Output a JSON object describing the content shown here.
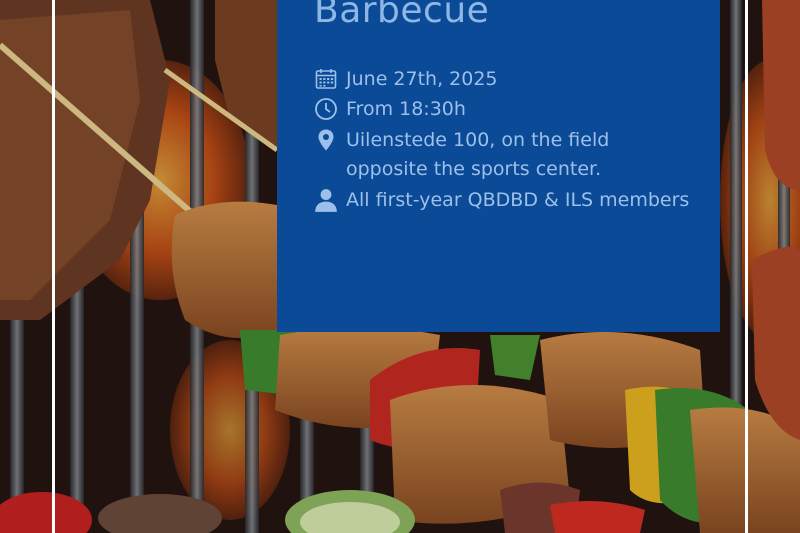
{
  "event": {
    "title": "Barbecue",
    "date": "June 27th, 2025",
    "time": "From 18:30h",
    "location": "Uilenstede 100, on the field opposite the sports center.",
    "audience": "All first-year QBDBD & ILS members"
  },
  "icons": {
    "date": "calendar-icon",
    "time": "clock-icon",
    "location": "map-pin-icon",
    "audience": "person-icon"
  },
  "colors": {
    "card_background": "#0a4a96",
    "text": "#9dc0ea",
    "title": "#8fb7e6",
    "divider_lines": "#ffffff"
  }
}
